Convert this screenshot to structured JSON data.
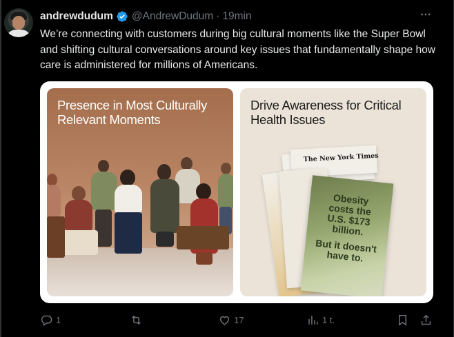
{
  "tweet": {
    "author_name": "andrewdudum",
    "handle": "@AndrewDudum",
    "separator": "·",
    "time": "19min",
    "text": "We’re connecting with customers during big cultural moments like the Super Bowl and shifting cultural conversations around key issues that fundamentally shape how care is administered for millions of Americans.",
    "more_icon": "more-dots-icon",
    "verified_icon": "verified-badge-icon",
    "verified_color": "#1d9bf0"
  },
  "media": {
    "left_panel": {
      "title": "Presence in Most Culturally Relevant Moments",
      "background": "#a46e4d"
    },
    "right_panel": {
      "title": "Drive Awareness for Critical Health Issues",
      "background": "#ebe3d8",
      "newspaper_name": "The New York Times",
      "ad_headline": "Obesity costs the U.S. $173 billion.",
      "ad_tagline": "But it doesn't have to."
    }
  },
  "actions": {
    "reply": {
      "icon": "reply-icon",
      "count": "1"
    },
    "repost": {
      "icon": "repost-icon",
      "count": ""
    },
    "like": {
      "icon": "heart-icon",
      "count": "17"
    },
    "views": {
      "icon": "analytics-icon",
      "count": "1 t."
    },
    "bookmark": {
      "icon": "bookmark-icon"
    },
    "share": {
      "icon": "share-icon"
    }
  },
  "colors": {
    "background": "#000000",
    "text": "#e7e9ea",
    "muted": "#71767b"
  }
}
